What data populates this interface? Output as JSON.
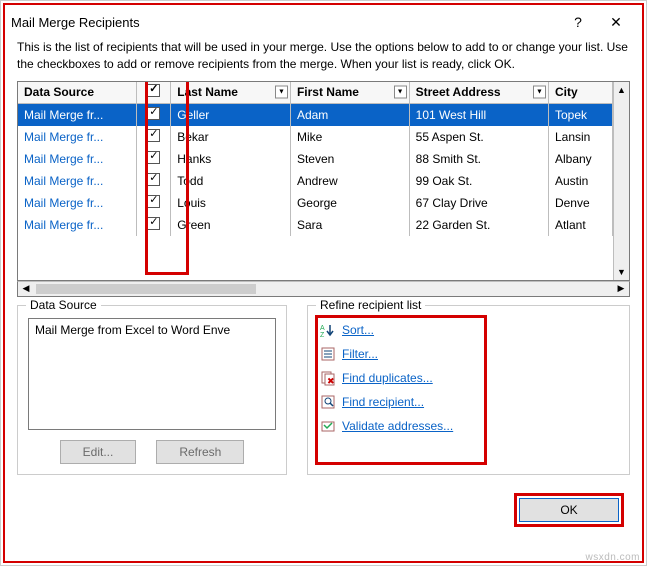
{
  "dialog": {
    "title": "Mail Merge Recipients",
    "help": "?",
    "close": "✕",
    "instructions": "This is the list of recipients that will be used in your merge.  Use the options below to add to or change your list.  Use the checkboxes to add or remove recipients from the merge.  When your list is ready, click OK."
  },
  "columns": {
    "data_source": "Data Source",
    "last_name": "Last Name",
    "first_name": "First Name",
    "street_address": "Street Address",
    "city": "City"
  },
  "rows": [
    {
      "ds": "Mail Merge fr...",
      "checked": true,
      "last": "Geller",
      "first": "Adam",
      "addr": "101 West Hill",
      "city": "Topek",
      "selected": true
    },
    {
      "ds": "Mail Merge fr...",
      "checked": true,
      "last": "Bekar",
      "first": "Mike",
      "addr": "55 Aspen St.",
      "city": "Lansin",
      "selected": false
    },
    {
      "ds": "Mail Merge fr...",
      "checked": true,
      "last": "Hanks",
      "first": "Steven",
      "addr": "88 Smith St.",
      "city": "Albany",
      "selected": false
    },
    {
      "ds": "Mail Merge fr...",
      "checked": true,
      "last": "Todd",
      "first": "Andrew",
      "addr": "99 Oak St.",
      "city": "Austin",
      "selected": false
    },
    {
      "ds": "Mail Merge fr...",
      "checked": true,
      "last": "Louis",
      "first": "George",
      "addr": "67 Clay Drive",
      "city": "Denve",
      "selected": false
    },
    {
      "ds": "Mail Merge fr...",
      "checked": true,
      "last": "Green",
      "first": "Sara",
      "addr": "22 Garden St.",
      "city": "Atlant",
      "selected": false
    }
  ],
  "data_source": {
    "label": "Data Source",
    "item": "Mail Merge from Excel to Word Enve",
    "edit": "Edit...",
    "refresh": "Refresh"
  },
  "refine": {
    "label": "Refine recipient list",
    "sort": "Sort...",
    "filter": "Filter...",
    "duplicates": "Find duplicates...",
    "find": "Find recipient...",
    "validate": "Validate addresses..."
  },
  "footer": {
    "ok": "OK"
  },
  "watermark": "wsxdn.com"
}
